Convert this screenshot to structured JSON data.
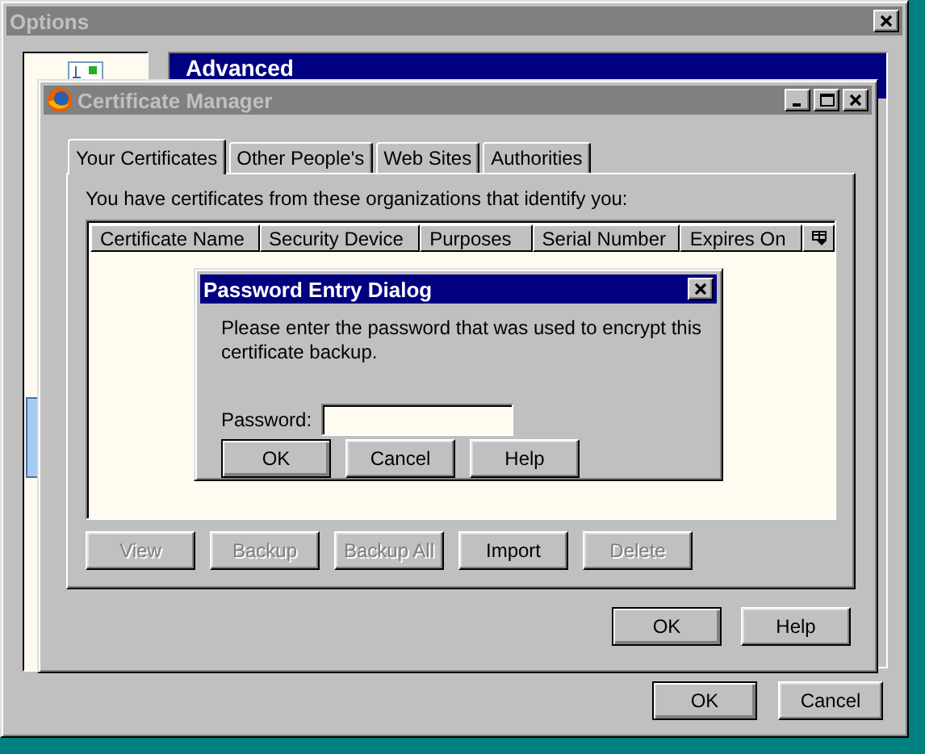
{
  "options_window": {
    "title": "Options",
    "active": false,
    "section_title": "Advanced",
    "buttons": [
      {
        "label": "OK",
        "default": true
      },
      {
        "label": "Cancel",
        "default": false
      }
    ]
  },
  "certificate_manager": {
    "title": "Certificate Manager",
    "active": false,
    "tabs": [
      {
        "label": "Your Certificates",
        "selected": true
      },
      {
        "label": "Other People's",
        "selected": false
      },
      {
        "label": "Web Sites",
        "selected": false
      },
      {
        "label": "Authorities",
        "selected": false
      }
    ],
    "intro": "You have certificates from these organizations that identify you:",
    "table": {
      "columns": [
        "Certificate Name",
        "Security Device",
        "Purposes",
        "Serial Number",
        "Expires On"
      ]
    },
    "actions": [
      {
        "label": "View",
        "disabled": true
      },
      {
        "label": "Backup",
        "disabled": true
      },
      {
        "label": "Backup All",
        "disabled": true
      },
      {
        "label": "Import",
        "disabled": false
      },
      {
        "label": "Delete",
        "disabled": true
      }
    ],
    "buttons": [
      {
        "label": "OK",
        "default": true
      },
      {
        "label": "Help",
        "default": false
      }
    ]
  },
  "password_dialog": {
    "title": "Password Entry Dialog",
    "active": true,
    "message": "Please enter the password that was used to encrypt this certificate backup.",
    "field_label": "Password:",
    "buttons": [
      {
        "label": "OK",
        "default": true
      },
      {
        "label": "Cancel",
        "default": false
      },
      {
        "label": "Help",
        "default": false
      }
    ]
  }
}
